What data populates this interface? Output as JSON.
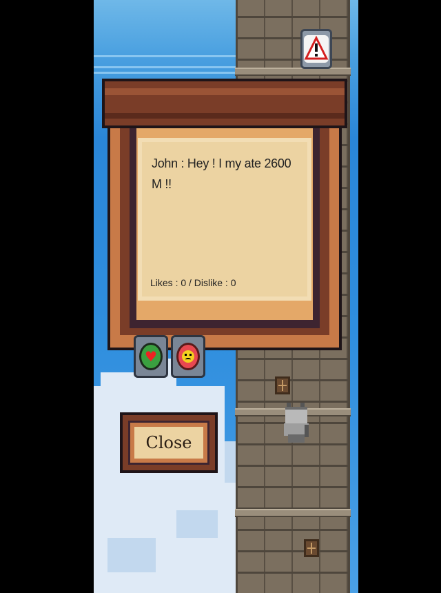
{
  "dialog": {
    "message": "John : Hey ! I my ate 2600 M !!",
    "likes_text": "Likes : 0 / Dislike : 0"
  },
  "buttons": {
    "close_label": "Close",
    "like_icon": "heart-icon",
    "dislike_icon": "sad-face-icon",
    "warning_icon": "warning-icon"
  },
  "colors": {
    "sky": "#2f8ede",
    "board_dark": "#7a3d28",
    "board_light": "#c87a48",
    "paper": "#ecd3a2",
    "like_green": "#3aa040",
    "dislike_red": "#e84850"
  }
}
